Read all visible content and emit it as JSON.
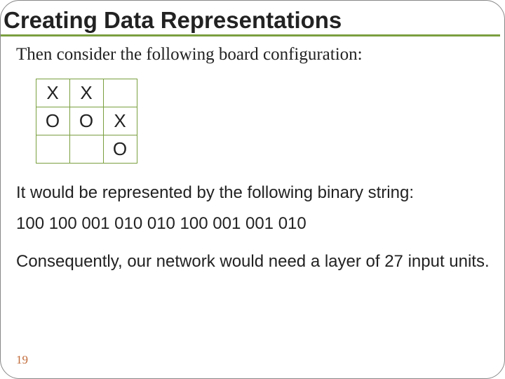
{
  "title": "Creating Data Representations",
  "intro": "Then consider the following board configuration:",
  "board": {
    "rows": [
      [
        "X",
        "X",
        ""
      ],
      [
        "O",
        "O",
        "X"
      ],
      [
        "",
        "",
        "O"
      ]
    ]
  },
  "desc": "It would be represented by the following binary string:",
  "binary": "100 100 001 010 010 100 001 001 010",
  "conclusion": "Consequently, our network would need a layer of 27 input units.",
  "page": "19"
}
